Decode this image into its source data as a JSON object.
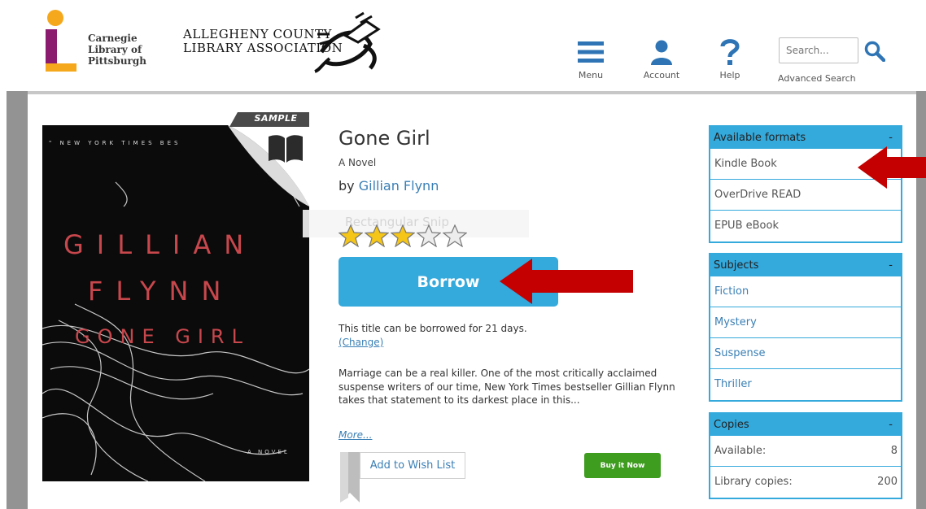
{
  "header": {
    "clp_logo_lines": [
      "Carnegie",
      "Library of",
      "Pittsburgh"
    ],
    "acla_logo_lines": [
      "ALLEGHENY COUNTY",
      "LIBRARY ASSOCIATION"
    ],
    "nav": {
      "menu_label": "Menu",
      "account_label": "Account",
      "help_label": "Help"
    },
    "search": {
      "placeholder": "Search...",
      "advanced_label": "Advanced Search"
    }
  },
  "cover": {
    "sample_label": "SAMPLE",
    "top_text": "\" NEW YORK TIMES BES",
    "author_line1": "GILLIAN",
    "author_line2": "FLYNN",
    "title_line": "GONE GIRL",
    "novel_label": "A NOVEL"
  },
  "overlay": {
    "rectangular_snip": "Rectangular Snip"
  },
  "book": {
    "title": "Gone Girl",
    "subtitle": "A Novel",
    "by_prefix": "by ",
    "author": "Gillian Flynn",
    "rating": 3,
    "rating_max": 5,
    "borrow_label": "Borrow",
    "borrow_note": "This title can be borrowed for 21 days.",
    "change_label": "(Change)",
    "description": "Marriage can be a real killer. One of the most critically acclaimed suspense writers of our time, New York Times bestseller Gillian Flynn takes that statement to its darkest place in this...",
    "more_label": "More...",
    "wishlist_label": "Add to Wish List",
    "buy_label": "Buy it Now"
  },
  "sidebar": {
    "formats": {
      "title": "Available formats",
      "toggle": "-",
      "items": [
        "Kindle Book",
        "OverDrive READ",
        "EPUB eBook"
      ]
    },
    "subjects": {
      "title": "Subjects",
      "toggle": "-",
      "items": [
        "Fiction",
        "Mystery",
        "Suspense",
        "Thriller"
      ]
    },
    "copies": {
      "title": "Copies",
      "toggle": "-",
      "available_label": "Available:",
      "available_value": "8",
      "library_label": "Library copies:",
      "library_value": "200"
    }
  },
  "colors": {
    "accent_blue": "#34a9dc",
    "link_blue": "#3a7fb5",
    "buy_green": "#3e9c1f",
    "arrow_red": "#c40000",
    "star_gold": "#f5c518",
    "clp_purple": "#8b1b6e",
    "clp_orange": "#f5a81c"
  }
}
